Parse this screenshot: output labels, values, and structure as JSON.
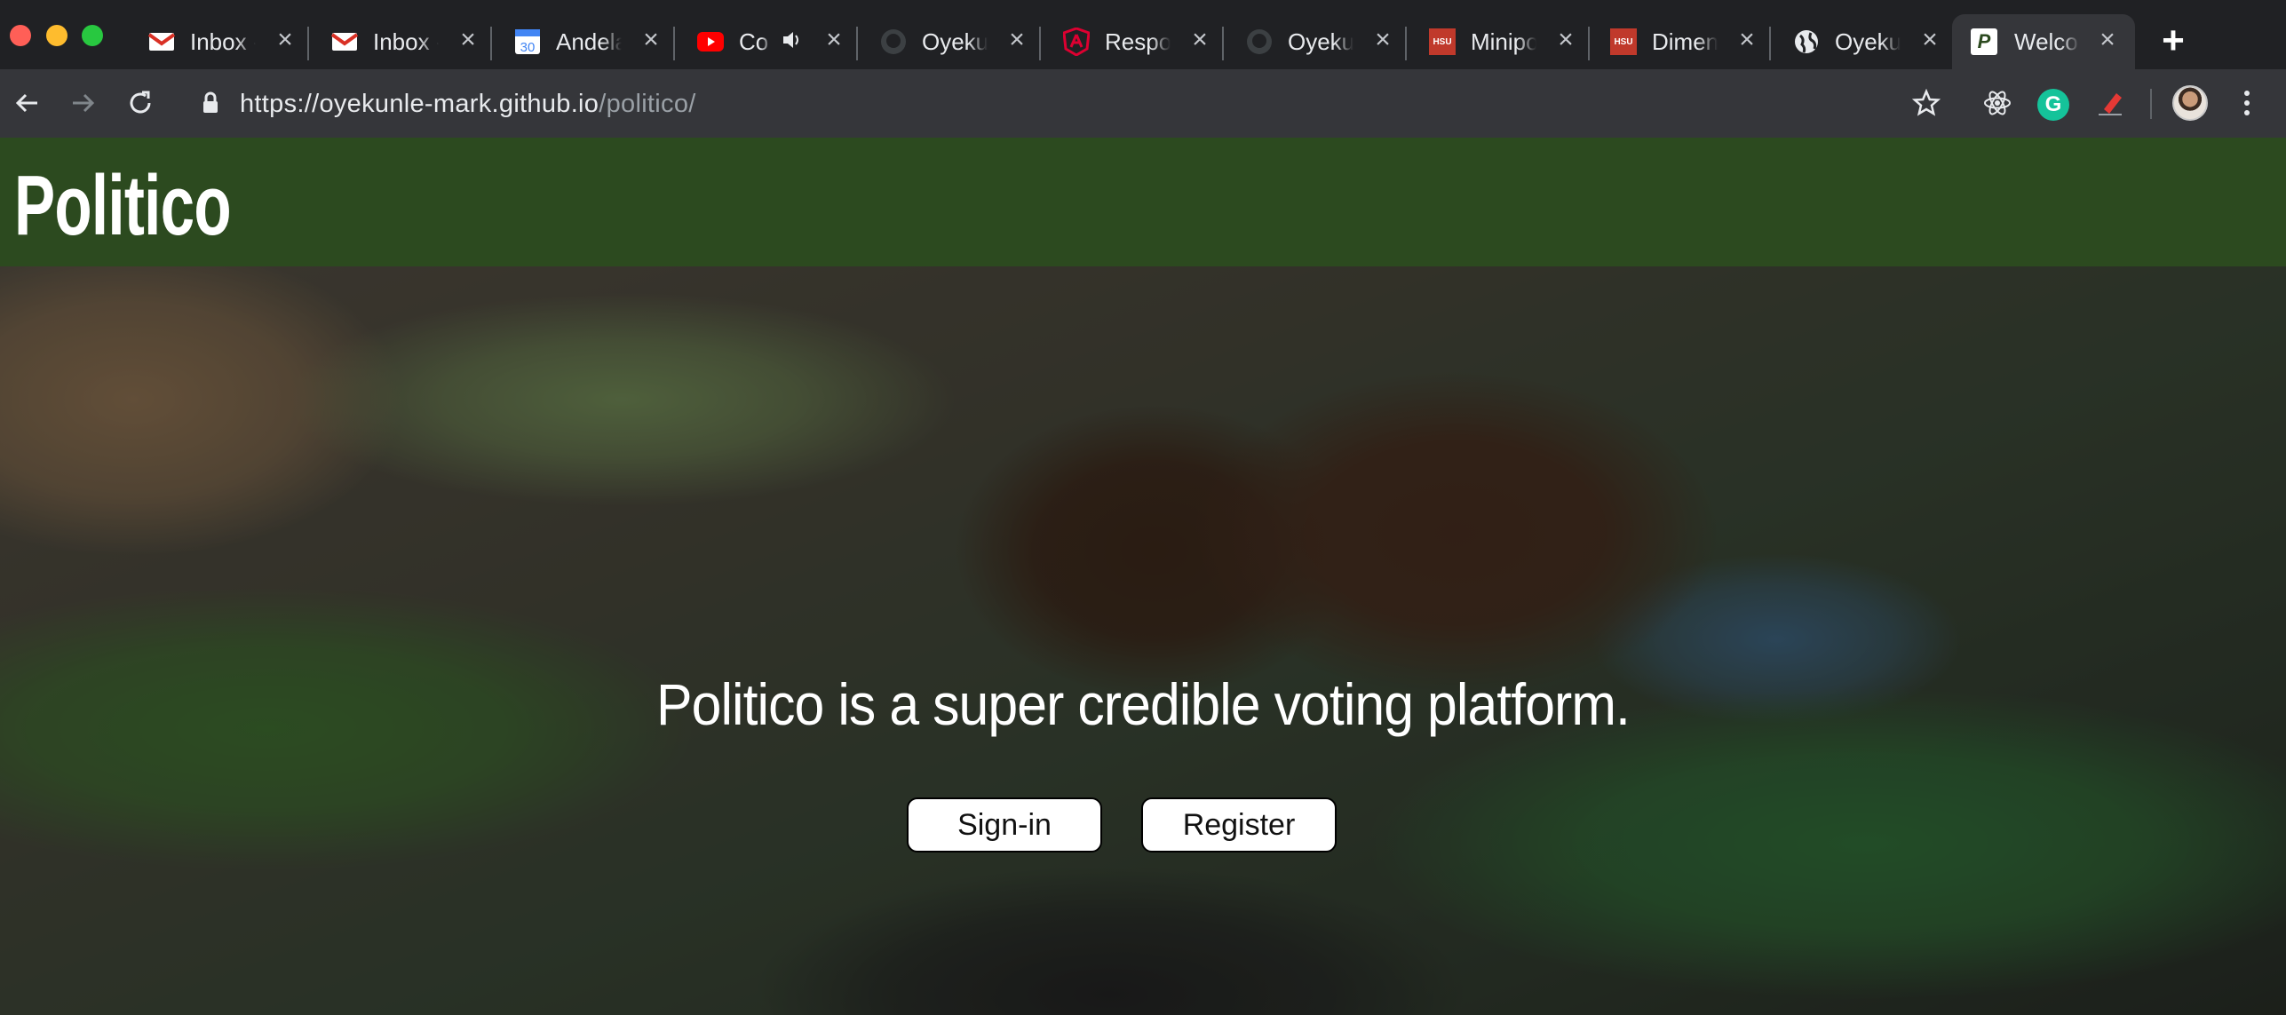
{
  "browser": {
    "tabs": [
      {
        "title": "Inbox -",
        "icon": "gmail-icon",
        "muted": false
      },
      {
        "title": "Inbox -",
        "icon": "gmail-icon",
        "muted": false
      },
      {
        "title": "Andela",
        "icon": "calendar-icon",
        "calendar_day": "30",
        "muted": false
      },
      {
        "title": "Co",
        "icon": "youtube-icon",
        "muted": true
      },
      {
        "title": "Oyekur",
        "icon": "github-icon",
        "muted": false
      },
      {
        "title": "Respor",
        "icon": "angular-icon",
        "muted": false
      },
      {
        "title": "Oyekur",
        "icon": "github-icon",
        "muted": false
      },
      {
        "title": "Minipo",
        "icon": "hsu-icon",
        "badge": "HSU",
        "muted": false
      },
      {
        "title": "Dimens",
        "icon": "hsu-icon",
        "badge": "HSU",
        "muted": false
      },
      {
        "title": "Oyeku",
        "icon": "globe-icon",
        "muted": false
      },
      {
        "title": "Welcor",
        "icon": "politico-icon",
        "badge": "P",
        "active": true
      }
    ],
    "url_host": "https://oyekunle-mark.github.io",
    "url_path": "/politico/",
    "grammarly_label": "G",
    "colors": {
      "tabstrip": "#202124",
      "toolbar": "#35363a"
    }
  },
  "page": {
    "brand": "Politico",
    "tagline": "Politico is a super credible voting platform.",
    "buttons": {
      "signin": "Sign-in",
      "register": "Register"
    },
    "colors": {
      "header_bg": "#2c4a1f",
      "button_bg": "#ffffff"
    }
  }
}
